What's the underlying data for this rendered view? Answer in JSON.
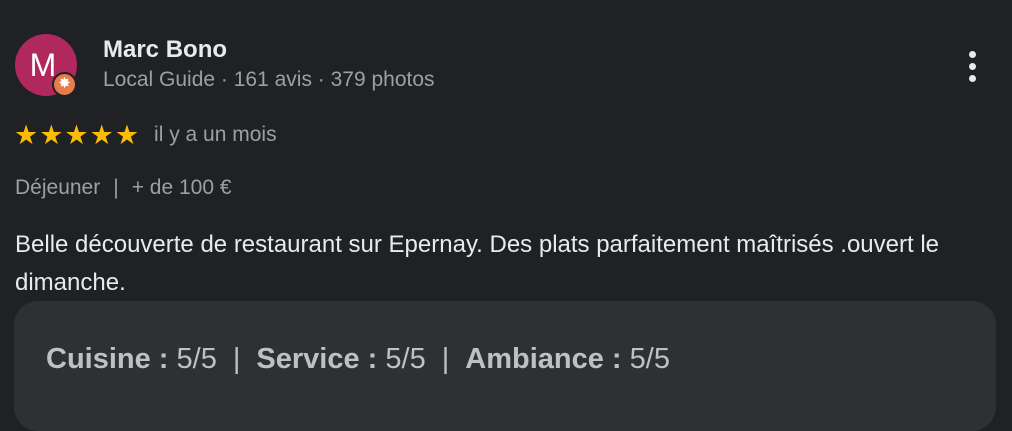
{
  "author": {
    "initial": "M",
    "name": "Marc Bono",
    "meta": "Local Guide · 161 avis · 379 photos",
    "badge_icon": "local-guide-star-icon",
    "avatar_color": "#b0285c",
    "badge_color": "#e67c4c"
  },
  "rating": {
    "stars": 5,
    "max": 5,
    "stars_text": "★★★★★",
    "date": "il y a un mois",
    "star_color": "#fbbc04"
  },
  "meta": {
    "meal": "Déjeuner",
    "separator": "|",
    "price": "+ de 100 €"
  },
  "review": {
    "text": "Belle découverte de restaurant sur Epernay. Des plats parfaitement maîtrisés .ouvert le dimanche."
  },
  "scores": {
    "separator": "|",
    "cuisine_label": "Cuisine :",
    "cuisine_value": "5/5",
    "service_label": "Service :",
    "service_value": "5/5",
    "ambiance_label": "Ambiance :",
    "ambiance_value": "5/5"
  },
  "icons": {
    "more": "more-vert-icon"
  }
}
